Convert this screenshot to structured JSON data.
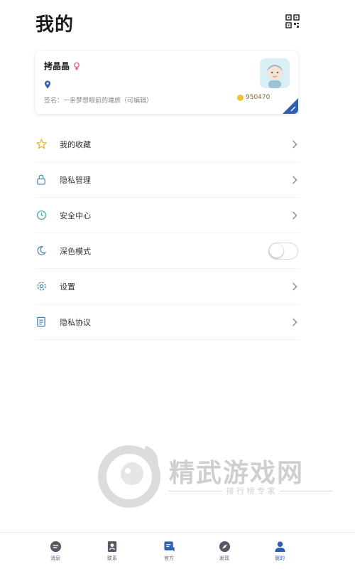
{
  "header": {
    "title": "我的",
    "qr_icon": "qr-code-icon"
  },
  "profile": {
    "nickname": "拷晶晶",
    "gender_icon": "female-icon",
    "location_icon": "location-pin-icon",
    "signature": "签名：一亲梦想眼前的端旅（可编辑）",
    "coins": "950470",
    "avatar_icon": "avatar-icon"
  },
  "menu": [
    {
      "label": "我的收藏",
      "icon": "star-icon",
      "icon_color": "#e8b23a",
      "trailing": "chevron"
    },
    {
      "label": "隐私管理",
      "icon": "lock-icon",
      "icon_color": "#3b8fa6",
      "trailing": "chevron"
    },
    {
      "label": "安全中心",
      "icon": "shield-clock-icon",
      "icon_color": "#3ba6a6",
      "trailing": "chevron"
    },
    {
      "label": "深色模式",
      "icon": "moon-icon",
      "icon_color": "#3b7fa6",
      "trailing": "toggle",
      "toggle_on": false
    },
    {
      "label": "设置",
      "icon": "gear-icon",
      "icon_color": "#3b7fa6",
      "trailing": "chevron"
    },
    {
      "label": "隐私协议",
      "icon": "document-icon",
      "icon_color": "#3b7fa6",
      "trailing": "chevron"
    }
  ],
  "watermark": {
    "title": "精武游戏网",
    "subtitle": "排 行 榜 专 家"
  },
  "tabs": [
    {
      "label": "消息",
      "icon": "message-icon",
      "active": false
    },
    {
      "label": "联系",
      "icon": "contacts-icon",
      "active": false
    },
    {
      "label": "官方",
      "icon": "official-icon",
      "active": false
    },
    {
      "label": "发现",
      "icon": "compass-icon",
      "active": false
    },
    {
      "label": "我的",
      "icon": "person-icon",
      "active": true
    }
  ],
  "colors": {
    "accent": "#2f5fb3",
    "coin": "#f0c23b",
    "avatar_bg": "#d9eef5"
  }
}
